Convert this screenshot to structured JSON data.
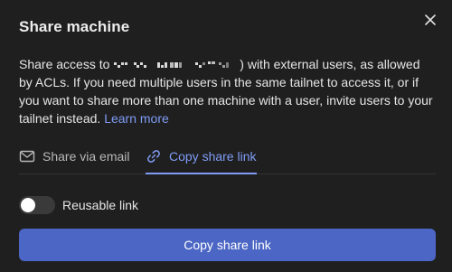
{
  "dialog": {
    "title": "Share machine",
    "description": {
      "part1": "Share access to",
      "part2": ") with external users, as allowed by ACLs. If you need multiple users in the same tailnet to access it, or if you want to share more than one machine with a user, invite users to your tailnet instead.",
      "learn_more": "Learn more"
    }
  },
  "tabs": [
    {
      "label": "Share via email",
      "icon": "mail-icon",
      "active": false
    },
    {
      "label": "Copy share link",
      "icon": "link-icon",
      "active": true
    }
  ],
  "reusable_toggle": {
    "label": "Reusable link",
    "enabled": false
  },
  "primary_button": {
    "label": "Copy share link"
  },
  "colors": {
    "background": "#1f1f1f",
    "accent": "#7f9cf5",
    "button": "#4b66c4"
  }
}
